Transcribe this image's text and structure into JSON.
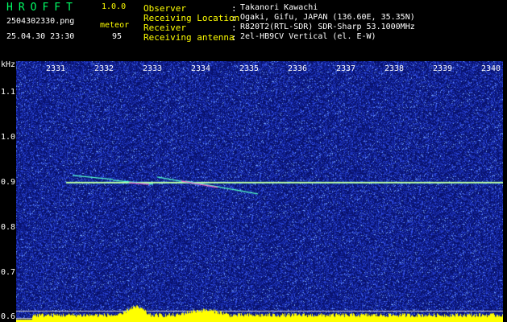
{
  "header": {
    "app_title": "HROFFT",
    "app_version": "1.0.0",
    "file_name": "2504302330.png",
    "mode_label": "meteor",
    "date_time": "25.04.30 23:30",
    "count_value": "95",
    "info": [
      {
        "label": "Observer",
        "value": "Takanori Kawachi"
      },
      {
        "label": "Receiving Location",
        "value": "Ogaki, Gifu, JAPAN (136.60E, 35.35N)"
      },
      {
        "label": "Receiver",
        "value": "R820T2(RTL-SDR) SDR-Sharp 53.1000MHz"
      },
      {
        "label": "Receiving antenna",
        "value": "2el-HB9CV Vertical (el. E-W)"
      }
    ]
  },
  "colors": {
    "background": "#000000",
    "noise": "#1a2a9a",
    "signal": "#ffff00",
    "carrier": "#66ffcc",
    "text_yellow": "#ffff00",
    "text_green": "#00ff66"
  },
  "chart_data": {
    "type": "heatmap",
    "ylabel": "kHz",
    "x_ticks": [
      "2331",
      "2332",
      "2333",
      "2334",
      "2335",
      "2336",
      "2337",
      "2338",
      "2339",
      "2340"
    ],
    "y_ticks": [
      "1.1",
      "1.0",
      "0.9",
      "0.8",
      "0.7",
      "0.6"
    ],
    "ylim": [
      0.59,
      1.17
    ],
    "carrier_frequency_khz": 0.9
  }
}
